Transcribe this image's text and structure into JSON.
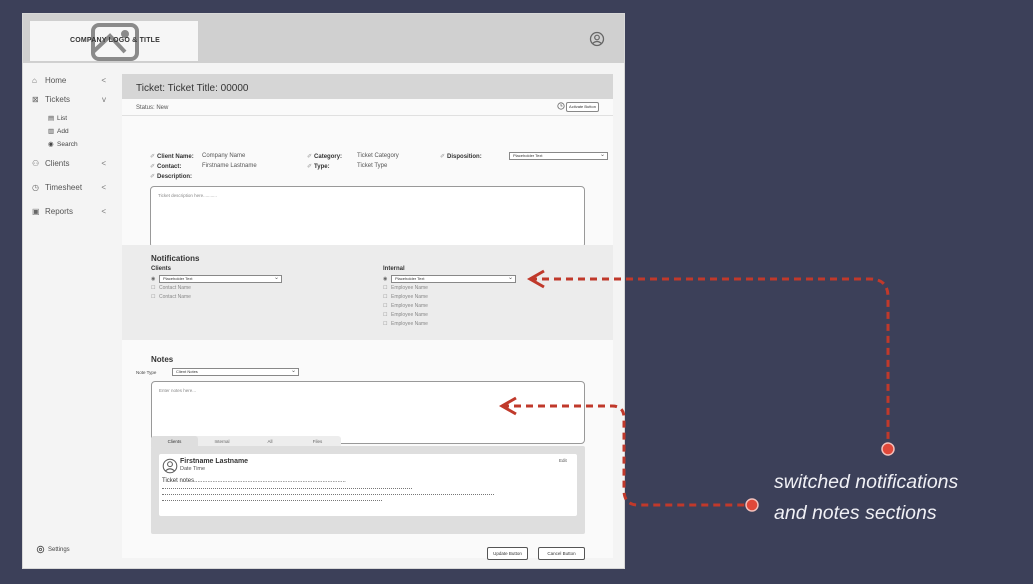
{
  "header": {
    "logo_text": "COMPANY LOGO & TITLE",
    "logo_icon": "image-placeholder-icon",
    "user_icon": "user-circle-icon"
  },
  "sidebar": {
    "items": [
      {
        "label": "Home",
        "icon": "home-icon",
        "chevron": "<"
      },
      {
        "label": "Tickets",
        "icon": "ticket-icon",
        "chevron": "v"
      },
      {
        "label": "Clients",
        "icon": "users-icon",
        "chevron": "<"
      },
      {
        "label": "Timesheet",
        "icon": "timesheet-icon",
        "chevron": "<"
      },
      {
        "label": "Reports",
        "icon": "report-icon",
        "chevron": "<"
      }
    ],
    "sub_items": [
      {
        "label": "List",
        "icon": "list-icon"
      },
      {
        "label": "Add",
        "icon": "add-icon"
      },
      {
        "label": "Search",
        "icon": "eye-icon"
      }
    ],
    "settings_label": "Settings"
  },
  "ticket": {
    "title": "Ticket: Ticket Title: 00000",
    "status": "Status: New",
    "activate_button": "Activate Button",
    "client_name_label": "Client Name:",
    "client_name_value": "Company Name",
    "contact_label": "Contact:",
    "contact_value": "Firstname Lastname",
    "description_label": "Description:",
    "category_label": "Category:",
    "category_value": "Ticket Category",
    "type_label": "Type:",
    "type_value": "Ticket Type",
    "disposition_label": "Disposition:",
    "disposition_value": "Placeholder Text",
    "description_placeholder": "Ticket description here..........."
  },
  "notifications": {
    "title": "Notifications",
    "clients_header": "Clients",
    "clients_select": "Placeholder Text",
    "client_contacts": [
      "Contact Name",
      "Contact Name"
    ],
    "internal_header": "Internal",
    "internal_select": "Placeholder Text",
    "employees": [
      "Employee Name",
      "Employee Name",
      "Employee Name",
      "Employee Name",
      "Employee Name"
    ]
  },
  "notes": {
    "title": "Notes",
    "note_type_label": "Note Type",
    "note_type_value": "Client Notes",
    "placeholder": "Enter notes here...",
    "tabs": [
      "Clients",
      "Internal",
      "All",
      "Files"
    ],
    "entry": {
      "author": "Firstname Lastname",
      "date": "Date Time",
      "edit": "Edit",
      "text": "Ticket notes..........................................................................................."
    }
  },
  "actions": {
    "update": "Update Button",
    "cancel": "Cancel Button"
  },
  "annotation": {
    "line1": "switched notifications",
    "line2": "and notes sections"
  },
  "colors": {
    "background": "#3c4059",
    "annotation_arrow": "#c0392b"
  }
}
